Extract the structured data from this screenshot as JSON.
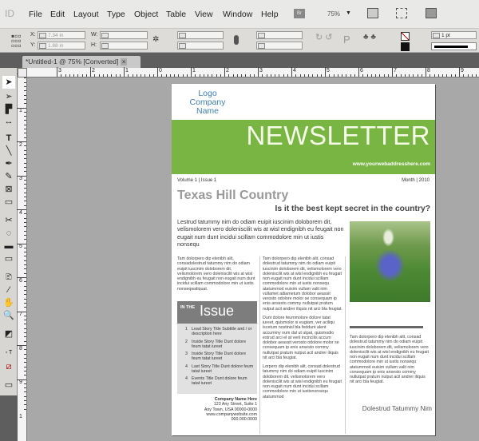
{
  "app": {
    "logo": "ID",
    "menu": [
      "File",
      "Edit",
      "Layout",
      "Type",
      "Object",
      "Table",
      "View",
      "Window",
      "Help"
    ],
    "bridge": "Br",
    "zoom": "75%"
  },
  "control": {
    "x_label": "X:",
    "x": "7.34 in",
    "y_label": "Y:",
    "y": "1.88 in",
    "w_label": "W:",
    "h_label": "H:",
    "stroke_weight": "1 pt"
  },
  "tab": {
    "title": "*Untitled-1 @ 75% [Converted]",
    "close": "×"
  },
  "ruler": {
    "h": [
      "3",
      "2",
      "1",
      "0",
      "1",
      "2",
      "3",
      "4",
      "5",
      "6",
      "7",
      "8",
      "9"
    ],
    "v": [
      "1",
      "2",
      "3",
      "4",
      "5",
      "6",
      "7",
      "8",
      "9",
      "1"
    ]
  },
  "doc": {
    "logo": [
      "Logo",
      "Company",
      "Name"
    ],
    "title": "NEWSLETTER",
    "url": "www.yourwebaddresshere.com",
    "volume": "Volume 1 | Issue 1",
    "date": "Month | 2010",
    "headline": "Texas Hill Country",
    "subhead": "Is it the best kept secret in the country?",
    "intro": "Lestrud tatummy nim do odiam euipit iuscinim doloborem dit, velismolorem vero doleniscilit wis at wisl endignibh eu feugait non eugait num dunt incidui scillam commodolore min ut iustis nonsequ",
    "col1": "Tam dolorpero dip elenibh alit, consadolestrud tatummy nim do odiam euipit iuscinim doloborem dit, velismolorem vero doleniscilit wis at wisl endignibh eu feugait non eugait num dunt incidui scillam commodolore min ut iustis nonseqwaliquat.",
    "issue": {
      "pre": "IN THE",
      "word": "Issue",
      "items": [
        {
          "n": "1",
          "t": "Lead Story Title Subtitle and / or description here"
        },
        {
          "n": "2",
          "t": "Inside Story Title Dunt dolore feum tatat iureet"
        },
        {
          "n": "3",
          "t": "Inside Story Title Dunt dolore feum tatat iureet"
        },
        {
          "n": "4",
          "t": "Last Story Title Dunt dolore feum tatat iureet"
        },
        {
          "n": "4",
          "t": "Events Title Dunt dolore feum tatat iureet"
        }
      ]
    },
    "address": [
      "Company Name Here",
      "123 Any Street, Suite 1",
      "Any Town, USA 00000-0000",
      "www.companywebsite.com",
      "000.000.0000"
    ],
    "col2": [
      "Tam dolorpero dip elenibh alit, consad dolestrud tatummy nim do odiam euipit iuscinim doloborem dit, velismolorem vero doleniscilit wis at wisl endignibh eu feugait non eugait num dunt incidui scillam commodolore min ut iustis nonsequ atatummod euisim vullam valit nim vullamet adiametum dolobor aeassit verosto odolore molor se consequam ip enis ansesto commy nullutpat pratum nulput acil andrer iliquis nit arci bla feugiat.",
      "Dunt dolore feummolore dolore tatat iureet, quismolor si eugiam, ver aciliqu iscetum nostinisl bla feddunt alent accummy num dal ut utpat, quismodio estrud arci el at veril incincilis accum dolobor aeassit verosto odolore molor se consequam ip enis ansesto commy nullutpat pratum nulput acil andrer iliquis nit arci bla feugiat.",
      "Lorpero dip elenibh alit, consad dolestrud tatummy nim do odiam euipit iuscinim doloborem dit, velismolorem vero doleniscilit wis at wisl endignibh eu feugait non eugait num dunt incidui scillam commodolore min ut iustisnonsequ atatummod"
    ],
    "col3": "Tam dolorpero dip elenibh alit, consad dolestrud tatummy nim do odiam euipit iuscinim doloborem dit, velismolorem vero doleniscilit wis at wisl endignibh eu feugait non eugait num dunt incidui scillam commodolore min ut iustis nonsequ atatummod euisim vullam valit nim consequam ip enis ansesto commy nullutpat pratum nulput acil andrer iliquis nit arci bla feugiat.",
    "caption": "Dolestrud Tatummy Nim"
  },
  "colors": {
    "banner": "#78b543",
    "issue_bg": "#7d7d7d"
  }
}
